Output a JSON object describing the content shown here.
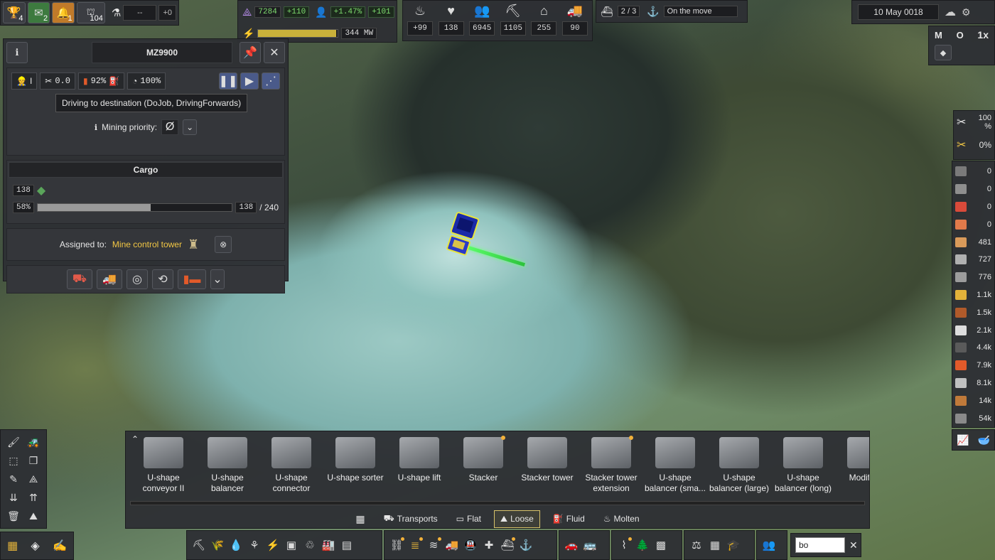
{
  "notifications": {
    "trophy_count": "4",
    "mail_count": "2",
    "alert_count": "1",
    "workers_count": "104",
    "research_value": "--",
    "research_delta": "+0"
  },
  "resources": {
    "unity": "7284",
    "unity_delta": "+110",
    "population_growth": "+1.47%",
    "population_delta": "+101",
    "power": "344 MW",
    "power_fill_fraction": 0.98
  },
  "stats": {
    "food": "+99",
    "health": "138",
    "population": "6945",
    "workers": "1105",
    "housing": "255",
    "vehicles": "90"
  },
  "ship": {
    "progress": "2 / 3",
    "status": "On the move"
  },
  "date": "10 May 0018",
  "speed": {
    "m": "M",
    "o": "O",
    "speed": "1x"
  },
  "vehicle": {
    "name": "MZ9900",
    "driver": "I",
    "maintenance": "0.0",
    "fuel": "92%",
    "efficiency": "100%",
    "status_tooltip": "Driving to destination (DoJob, DrivingForwards)",
    "mining_priority_label": "Mining priority:",
    "mining_priority_value": "Ø",
    "cargo_title": "Cargo",
    "cargo_item_amount": "138",
    "cargo_percent": "58%",
    "cargo_fill_fraction": 0.58,
    "cargo_current": "138",
    "cargo_max": "/ 240",
    "assigned_label": "Assigned to:",
    "assigned_value": "Mine control tower"
  },
  "maintenance_panel": {
    "maint_value": "100",
    "maint_unit": "%",
    "repair_value": "0%"
  },
  "right_resources": [
    {
      "value": "0",
      "color": "#7a7a7a"
    },
    {
      "value": "0",
      "color": "#8e8e8e"
    },
    {
      "value": "0",
      "color": "#d94a3a"
    },
    {
      "value": "0",
      "color": "#e27a4a"
    },
    {
      "value": "481",
      "color": "#d99a5a"
    },
    {
      "value": "727",
      "color": "#b0b0b0"
    },
    {
      "value": "776",
      "color": "#9c9c9c"
    },
    {
      "value": "1.1k",
      "color": "#e2b23a"
    },
    {
      "value": "1.5k",
      "color": "#b05a2a"
    },
    {
      "value": "2.1k",
      "color": "#dddddd"
    },
    {
      "value": "4.4k",
      "color": "#5a5a5a"
    },
    {
      "value": "7.9k",
      "color": "#e25a2a"
    },
    {
      "value": "8.1k",
      "color": "#c0c0c0"
    },
    {
      "value": "14k",
      "color": "#c07a3a"
    },
    {
      "value": "54k",
      "color": "#8a8a8a"
    }
  ],
  "build_items": [
    {
      "label": "U-shape conveyor II",
      "dot": false
    },
    {
      "label": "U-shape balancer",
      "dot": false
    },
    {
      "label": "U-shape connector",
      "dot": false
    },
    {
      "label": "U-shape sorter",
      "dot": false
    },
    {
      "label": "U-shape lift",
      "dot": false
    },
    {
      "label": "Stacker",
      "dot": true
    },
    {
      "label": "Stacker tower",
      "dot": false
    },
    {
      "label": "Stacker tower extension",
      "dot": true
    },
    {
      "label": "U-shape balancer (sma...",
      "dot": false
    },
    {
      "label": "U-shape balancer (large)",
      "dot": false
    },
    {
      "label": "U-shape balancer (long)",
      "dot": false
    },
    {
      "label": "Modify pil",
      "dot": false
    }
  ],
  "build_tabs": {
    "transports": "Transports",
    "flat": "Flat",
    "loose": "Loose",
    "fluid": "Fluid",
    "molten": "Molten"
  },
  "search": {
    "value": "bo"
  },
  "icons": {
    "trophy": "trophy-icon",
    "mail": "mail-icon",
    "bell": "bell-icon",
    "flask": "flask-icon"
  }
}
